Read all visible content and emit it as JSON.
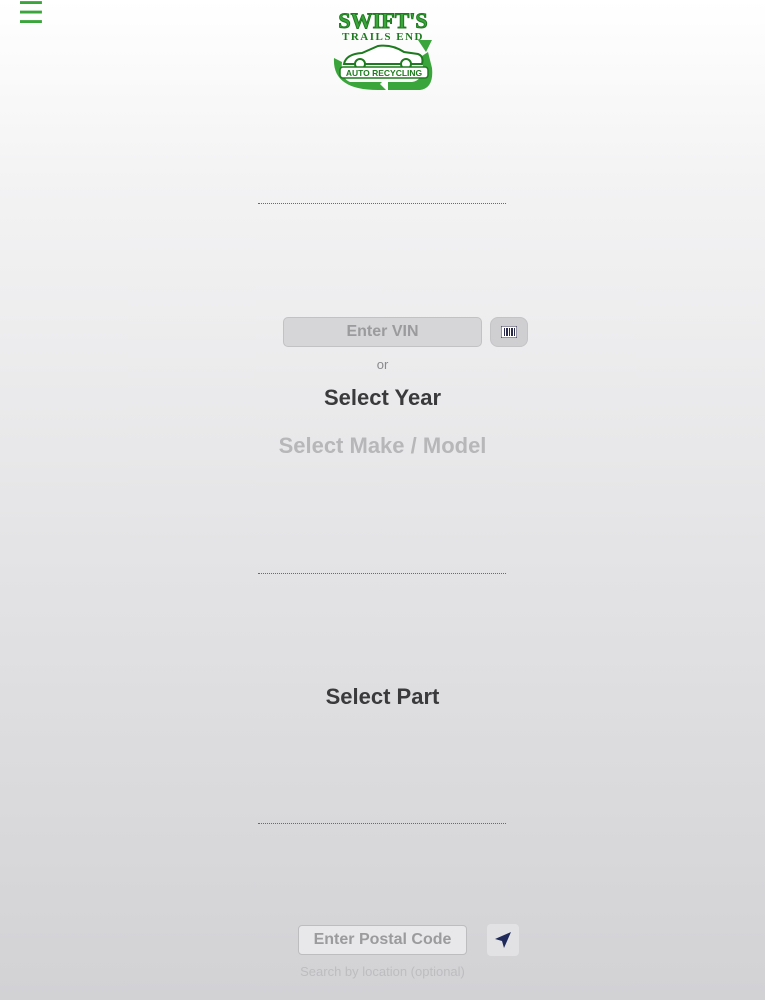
{
  "header": {
    "menu_icon": "hamburger-icon",
    "menu_glyph": "☰",
    "logo": {
      "line1": "SWIFT'S",
      "line2": "TRAILS END",
      "line3": "AUTO RECYCLING"
    }
  },
  "vin": {
    "placeholder": "Enter VIN",
    "scan_icon": "barcode-icon"
  },
  "or_label": "or",
  "vehicle": {
    "year_label": "Select Year",
    "make_model_label": "Select Make / Model"
  },
  "part": {
    "label": "Select Part"
  },
  "location": {
    "postal_placeholder": "Enter Postal Code",
    "locate_icon": "location-arrow-icon",
    "hint": "Search by location (optional)"
  },
  "colors": {
    "brand_green": "#3aa53a",
    "logo_dark_green": "#1e7a1e",
    "arrow_navy": "#1f2a5a"
  }
}
